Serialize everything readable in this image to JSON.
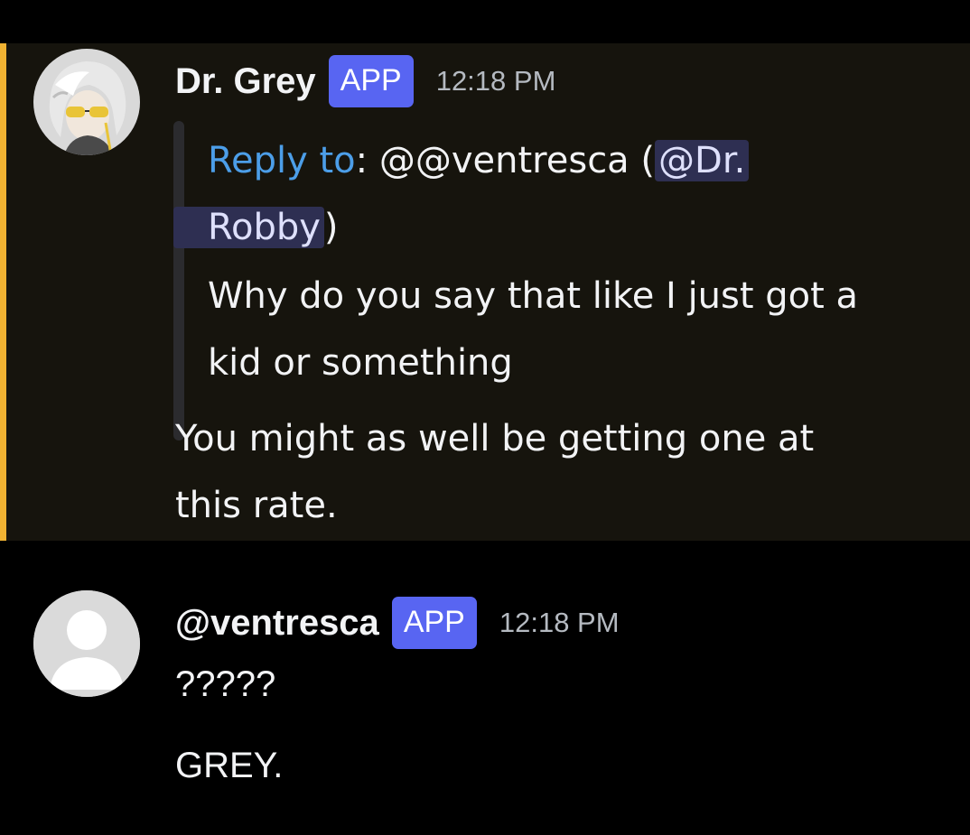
{
  "colors": {
    "background": "#000000",
    "highlight_background": "#16140d",
    "mention_bar": "#f0b232",
    "app_badge": "#5865f2",
    "reply_label": "#4c9ee8",
    "mention_background": "#2e2f52",
    "timestamp": "#b5bac1"
  },
  "messages": [
    {
      "author": "Dr. Grey",
      "badge": "APP",
      "time": "12:18 PM",
      "avatar_icon": "anime-character-avatar",
      "highlighted": true,
      "reply": {
        "label": "Reply to",
        "separator": ":",
        "target_prefix": "@",
        "target": "@ventresca",
        "open_paren": "(",
        "mention_line1": "@Dr.",
        "mention_line2": "Robby",
        "close_paren": ")",
        "quote_line1": "Why do you say that like I just got a",
        "quote_line2": "kid or something"
      },
      "body_line1": "You might as well be getting one at",
      "body_line2": "this rate."
    },
    {
      "author": "@ventresca",
      "badge": "APP",
      "time": "12:18 PM",
      "avatar_icon": "default-user-avatar-icon",
      "highlighted": false,
      "line1": "?????",
      "line2": "GREY."
    }
  ]
}
